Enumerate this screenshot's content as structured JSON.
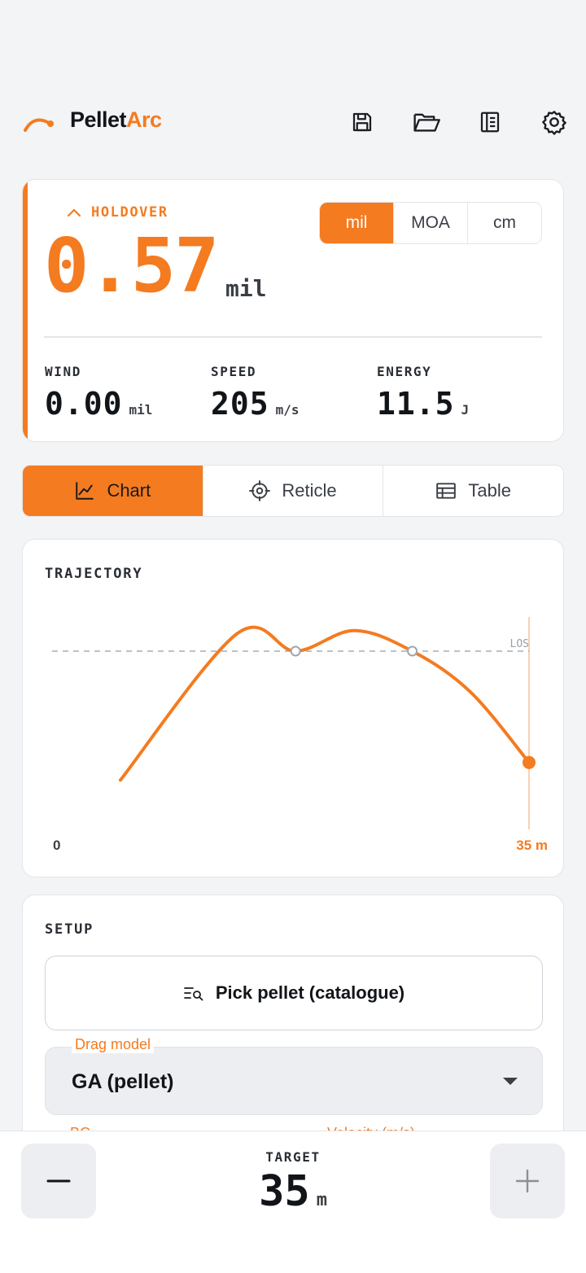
{
  "app": {
    "title_main": "Pellet",
    "title_accent": "Arc",
    "accent_color": "#f47b20"
  },
  "header": {
    "actions": [
      {
        "icon": "save-icon"
      },
      {
        "icon": "folder-open-icon"
      },
      {
        "icon": "notebook-icon"
      },
      {
        "icon": "settings-icon"
      }
    ]
  },
  "holdover": {
    "label": "HOLDOVER",
    "value": "0.57",
    "unit": "mil",
    "unit_options": [
      "mil",
      "MOA",
      "cm"
    ],
    "selected_unit": "mil",
    "stats": [
      {
        "label": "WIND",
        "value": "0.00",
        "unit": "mil"
      },
      {
        "label": "SPEED",
        "value": "205",
        "unit": "m/s"
      },
      {
        "label": "ENERGY",
        "value": "11.5",
        "unit": "J"
      }
    ]
  },
  "tabs": [
    {
      "label": "Chart",
      "icon": "line-chart-icon",
      "active": true
    },
    {
      "label": "Reticle",
      "icon": "crosshair-icon",
      "active": false
    },
    {
      "label": "Table",
      "icon": "table-icon",
      "active": false
    }
  ],
  "trajectory": {
    "title": "TRAJECTORY",
    "los_label": "LOS",
    "x_start_label": "0",
    "x_end_label": "35 m"
  },
  "chart_data": {
    "type": "line",
    "title": "TRAJECTORY",
    "xlabel": "",
    "ylabel": "",
    "x_range_label": [
      "0",
      "35 m"
    ],
    "reference_line": "LOS",
    "grid": false,
    "series": [
      {
        "x": [
          0,
          10,
          15,
          20,
          25,
          30,
          35
        ],
        "y": [
          -2.2,
          0.3,
          0.0,
          0.35,
          0.0,
          -0.7,
          -1.9
        ]
      }
    ],
    "series_color": "#f47b20"
  },
  "setup": {
    "title": "SETUP",
    "pick_pellet_label": "Pick pellet (catalogue)",
    "drag_model_label": "Drag model",
    "drag_model_value": "GA (pellet)",
    "peek_left": "BC",
    "peek_right": "Velocity (m/s)"
  },
  "target": {
    "label": "TARGET",
    "value": "35",
    "unit": "m",
    "decrement_icon": "minus-icon",
    "increment_icon": "plus-icon"
  }
}
